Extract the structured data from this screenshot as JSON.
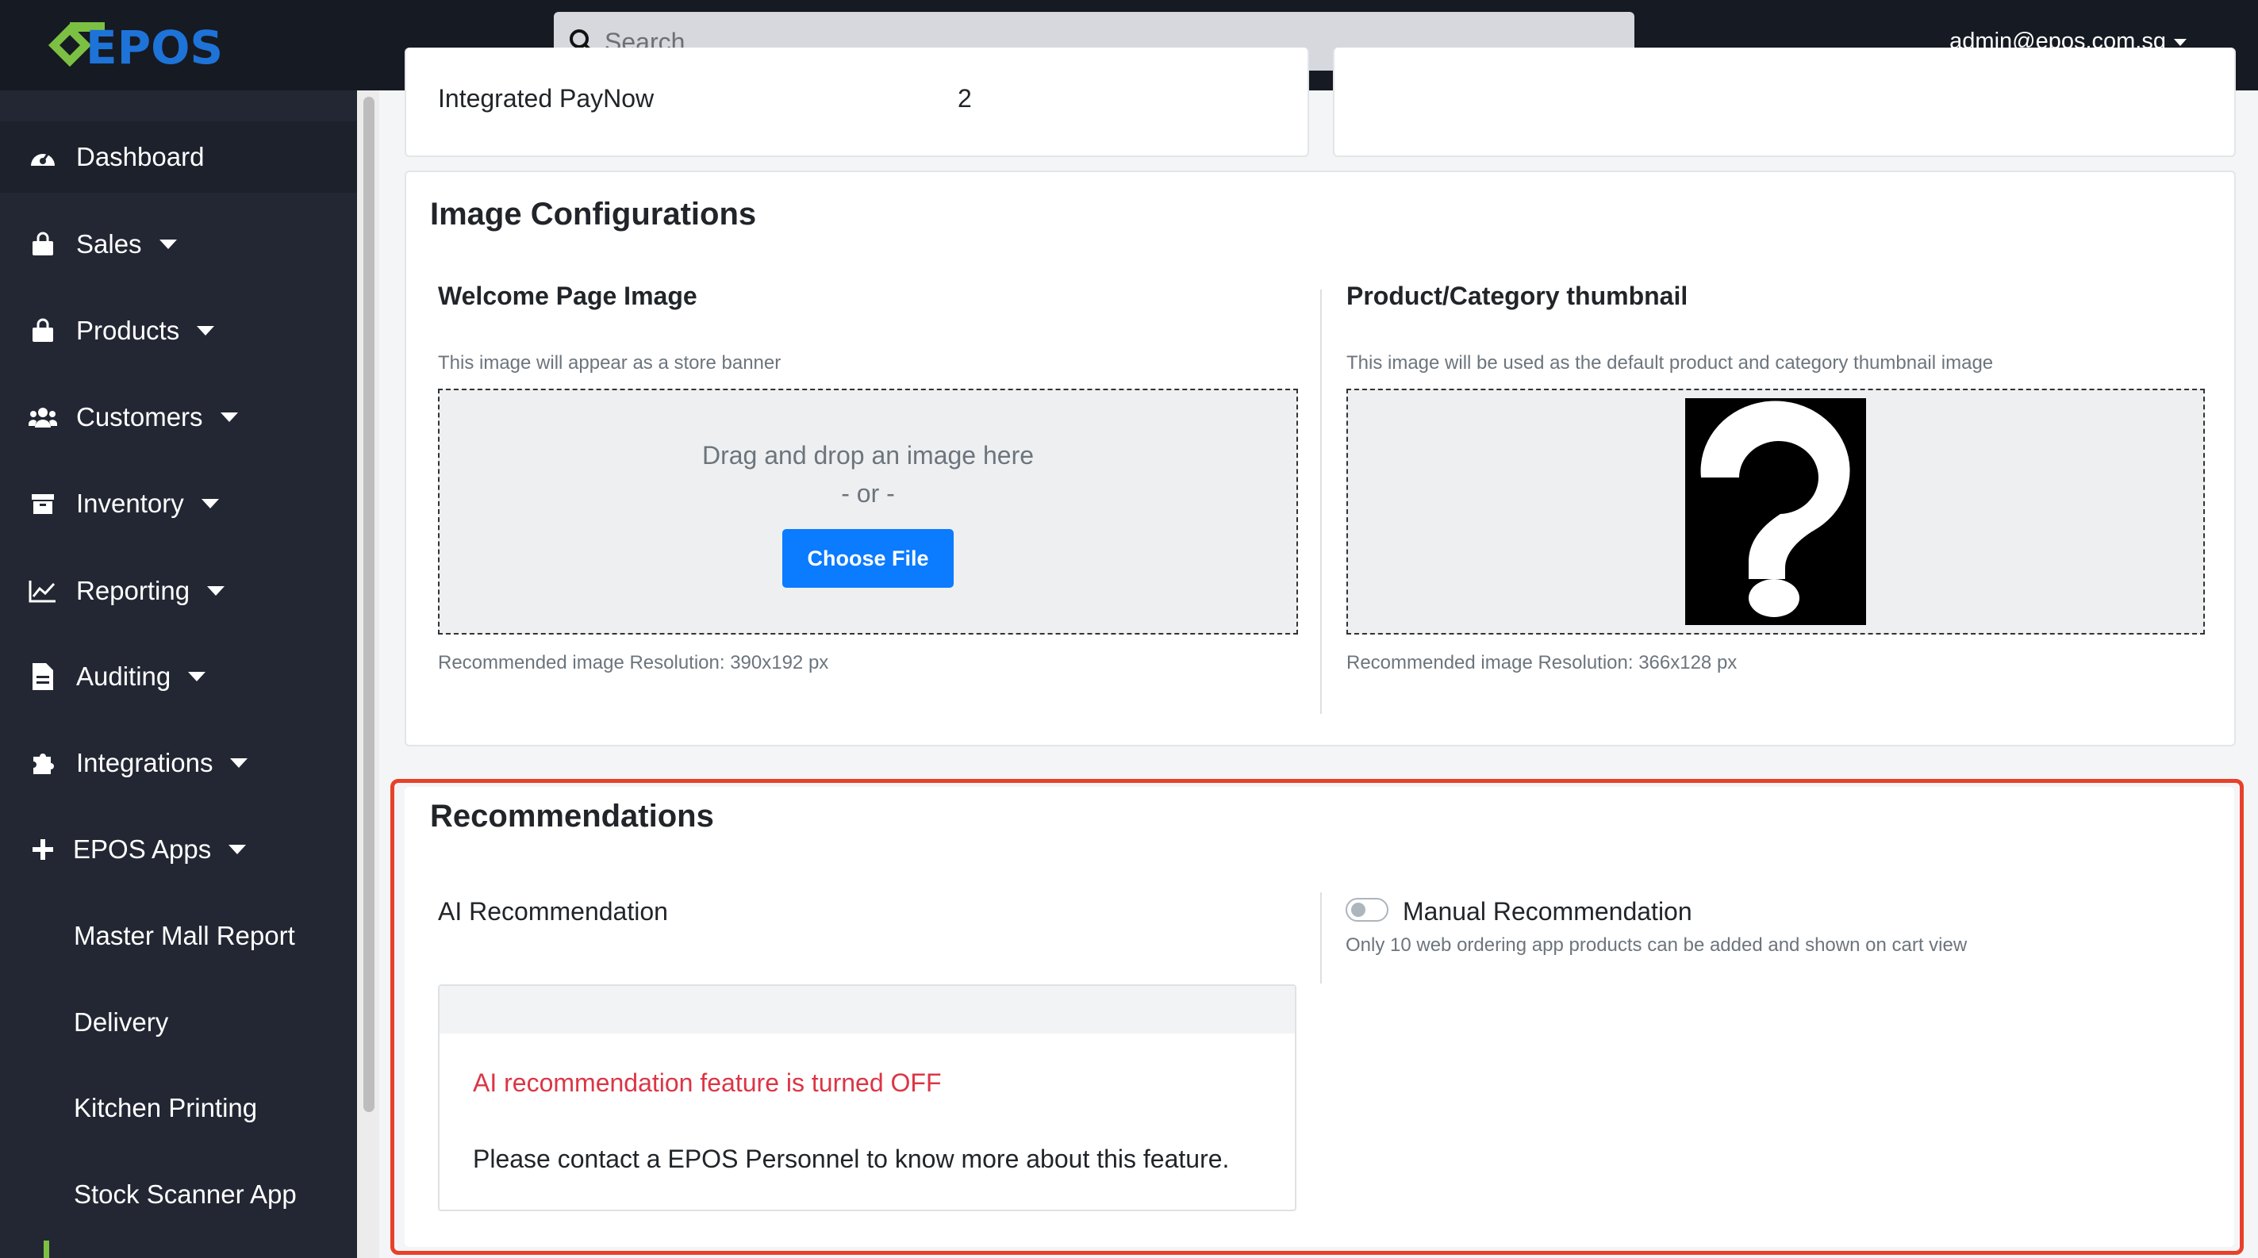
{
  "header": {
    "logo_text": "EPOS",
    "search_placeholder": "Search...",
    "user_email": "admin@epos.com.sg"
  },
  "sidebar": {
    "items": [
      {
        "label": "Dashboard",
        "icon": "dashboard-gauge-icon",
        "has_caret": false
      },
      {
        "label": "Sales",
        "icon": "shopping-bag-icon",
        "has_caret": true
      },
      {
        "label": "Products",
        "icon": "shopping-bag-icon",
        "has_caret": true
      },
      {
        "label": "Customers",
        "icon": "users-icon",
        "has_caret": true
      },
      {
        "label": "Inventory",
        "icon": "archive-box-icon",
        "has_caret": true
      },
      {
        "label": "Reporting",
        "icon": "line-chart-icon",
        "has_caret": true
      },
      {
        "label": "Auditing",
        "icon": "document-icon",
        "has_caret": true
      },
      {
        "label": "Integrations",
        "icon": "puzzle-piece-icon",
        "has_caret": true
      },
      {
        "label": "EPOS Apps",
        "icon": "plus-icon",
        "has_caret": true
      }
    ],
    "sub_items": [
      "Master Mall Report",
      "Delivery",
      "Kitchen Printing",
      "Stock Scanner App"
    ]
  },
  "summary": {
    "paynow_label": "Integrated PayNow",
    "paynow_value": "2"
  },
  "image_config": {
    "title": "Image Configurations",
    "welcome": {
      "title": "Welcome Page Image",
      "description": "This image will appear as a store banner",
      "drop_text": "Drag and drop an image here",
      "or_text": "- or -",
      "button_label": "Choose File",
      "resolution": "Recommended image Resolution: 390x192 px"
    },
    "thumbnail": {
      "title": "Product/Category thumbnail",
      "description": "This image will be used as the default product and category thumbnail image",
      "resolution": "Recommended image Resolution: 366x128 px"
    }
  },
  "recommendations": {
    "title": "Recommendations",
    "ai_label": "AI Recommendation",
    "ai_status": "AI recommendation feature is turned OFF",
    "ai_contact": "Please contact a EPOS Personnel to know more about this feature.",
    "manual_label": "Manual Recommendation",
    "manual_enabled": false,
    "manual_description": "Only 10 web ordering app products can be added and shown on cart view"
  },
  "colors": {
    "topbar_bg": "#161a22",
    "sidebar_bg": "#232733",
    "primary_button": "#0b7bff",
    "highlight_border": "#e8412b",
    "error_text": "#dc3545",
    "logo_green": "#7bc043",
    "logo_blue": "#1e73d8"
  }
}
